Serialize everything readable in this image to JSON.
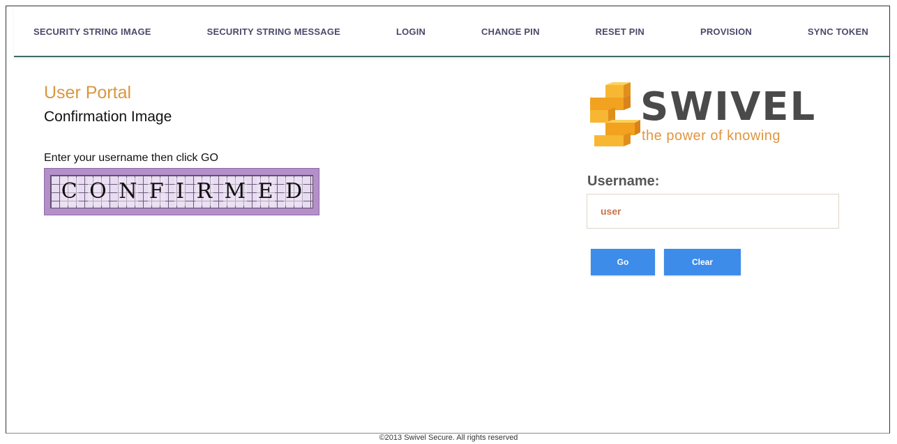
{
  "nav": {
    "items": [
      {
        "label": "SECURITY STRING IMAGE"
      },
      {
        "label": "SECURITY STRING MESSAGE"
      },
      {
        "label": "LOGIN"
      },
      {
        "label": "CHANGE PIN"
      },
      {
        "label": "RESET PIN"
      },
      {
        "label": "PROVISION"
      },
      {
        "label": "SYNC TOKEN"
      }
    ]
  },
  "main": {
    "title": "User Portal",
    "subtitle": "Confirmation Image",
    "instruction": "Enter your username then click GO",
    "captcha_chars": [
      "C",
      "O",
      "N",
      "F",
      "I",
      "R",
      "M",
      "E",
      "D"
    ]
  },
  "logo": {
    "brand": "SWIVEL",
    "tagline": "the power of knowing",
    "colors": {
      "orange": "#f2a21f",
      "gray": "#4a4a4a",
      "tagline": "#e0953f"
    }
  },
  "form": {
    "username_label": "Username:",
    "username_value": "user",
    "go_label": "Go",
    "clear_label": "Clear"
  },
  "footer": {
    "copyright": "©2013 Swivel Secure. All rights reserved"
  },
  "colors": {
    "accent_blue": "#3d8ce9",
    "title_orange": "#d9963f",
    "nav_border": "#3f6b63"
  }
}
